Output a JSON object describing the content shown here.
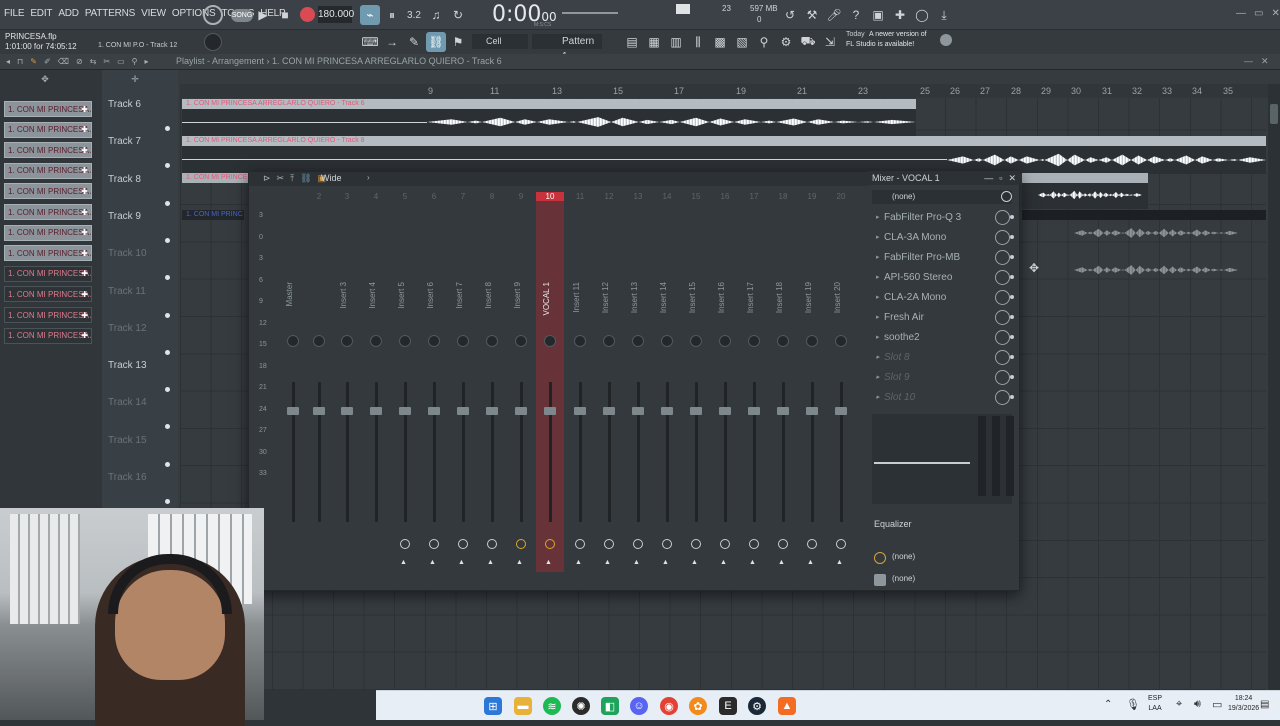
{
  "menu": [
    "FILE",
    "EDIT",
    "ADD",
    "PATTERNS",
    "VIEW",
    "OPTIONS",
    "TOOLS",
    "HELP"
  ],
  "transport": {
    "song_label": "SONG",
    "tempo": "180.000",
    "time": "0:00",
    "time_frac": "00",
    "time_sub": "M:S:CS",
    "cpu": "23",
    "mem": "597 MB",
    "poly": "0"
  },
  "project": {
    "file": "PRINCESA.flp",
    "position": "1:01:00 for 74:05:12",
    "hint": "1. CON MI P.O - Track 12"
  },
  "toolbar2": {
    "snap": "Cell",
    "pattern": "Pattern 1",
    "news_day": "Today",
    "news_text": "A newer version of",
    "news_text2": "FL Studio is available!"
  },
  "playlist": {
    "breadcrumb": "Playlist - Arrangement",
    "path": "1. CON MI PRINCESA ARREGLARLO QUIERO - Track 6"
  },
  "ruler": [
    "9",
    "11",
    "13",
    "15",
    "17",
    "19",
    "21",
    "23",
    "25",
    "26",
    "27",
    "28",
    "29",
    "30",
    "31",
    "32",
    "33",
    "34",
    "35"
  ],
  "clips": [
    "1. CON MI PRINCESA A...",
    "1. CON MI PRINCESA A...",
    "1. CON MI PRINCESA A...",
    "1. CON MI PRINCESA A...",
    "1. CON MI PRINCESA A...",
    "1. CON MI PRINCESA A...",
    "1. CON MI PRINCESA A...",
    "1. CON MI PRINCESA A...",
    "1. CON MI PRINCESA A...",
    "1. CON MI PRINCESA A...",
    "1. CON MI PRINCESA A...",
    "1. CON MI PRINCESA A..."
  ],
  "tracks": [
    {
      "label": "Track 6",
      "dim": false
    },
    {
      "label": "Track 7",
      "dim": false
    },
    {
      "label": "Track 8",
      "dim": false
    },
    {
      "label": "Track 9",
      "dim": false
    },
    {
      "label": "Track 10",
      "dim": true
    },
    {
      "label": "Track 11",
      "dim": true
    },
    {
      "label": "Track 12",
      "dim": true
    },
    {
      "label": "Track 13",
      "dim": false
    },
    {
      "label": "Track 14",
      "dim": true
    },
    {
      "label": "Track 15",
      "dim": true
    },
    {
      "label": "Track 16",
      "dim": true
    }
  ],
  "lane_titles": {
    "t6": "1. CON MI PRINCESA ARREGLARLO QUIERO - Track 6",
    "t7": "1. CON MI PRINCESA ARREGLARLO QUIERO - Track 8",
    "t8": "1. CON MI PRINCESA",
    "t9": "1. CON MI PRINC"
  },
  "mixer": {
    "title": "Mixer - VOCAL 1",
    "preset": "Wide",
    "route_none": "(none)",
    "db_scale": [
      "3",
      "0",
      "3",
      "6",
      "9",
      "12",
      "15",
      "18",
      "21",
      "24",
      "27",
      "30",
      "33"
    ],
    "strips": [
      {
        "num": "",
        "name": "Master"
      },
      {
        "num": "2",
        "name": ""
      },
      {
        "num": "3",
        "name": "Insert 3"
      },
      {
        "num": "4",
        "name": "Insert 4"
      },
      {
        "num": "5",
        "name": "Insert 5"
      },
      {
        "num": "6",
        "name": "Insert 6"
      },
      {
        "num": "7",
        "name": "Insert 7"
      },
      {
        "num": "8",
        "name": "Insert 8"
      },
      {
        "num": "9",
        "name": "Insert 9"
      },
      {
        "num": "10",
        "name": "VOCAL 1"
      },
      {
        "num": "11",
        "name": "Insert 11"
      },
      {
        "num": "12",
        "name": "Insert 12"
      },
      {
        "num": "13",
        "name": "Insert 13"
      },
      {
        "num": "14",
        "name": "Insert 14"
      },
      {
        "num": "15",
        "name": "Insert 15"
      },
      {
        "num": "16",
        "name": "Insert 16"
      },
      {
        "num": "17",
        "name": "Insert 17"
      },
      {
        "num": "18",
        "name": "Insert 18"
      },
      {
        "num": "19",
        "name": "Insert 19"
      },
      {
        "num": "20",
        "name": "Insert 20"
      }
    ],
    "slots": [
      {
        "name": "FabFilter Pro-Q 3",
        "empty": false
      },
      {
        "name": "CLA-3A Mono",
        "empty": false
      },
      {
        "name": "FabFilter Pro-MB",
        "empty": false
      },
      {
        "name": "API-560 Stereo",
        "empty": false
      },
      {
        "name": "CLA-2A Mono",
        "empty": false
      },
      {
        "name": "Fresh Air",
        "empty": false
      },
      {
        "name": "soothe2",
        "empty": false
      },
      {
        "name": "Slot 8",
        "empty": true
      },
      {
        "name": "Slot 9",
        "empty": true
      },
      {
        "name": "Slot 10",
        "empty": true
      }
    ],
    "eq_label": "Equalizer",
    "out_none_1": "(none)",
    "out_none_2": "(none)"
  },
  "tray": {
    "lang1": "ESP",
    "lang2": "LAA",
    "time": "18:24",
    "date": "19/3/2026"
  },
  "colors": {
    "accent": "#c8323c",
    "clip_text": "#e07b8c",
    "taskbar": "#e8eef6"
  }
}
